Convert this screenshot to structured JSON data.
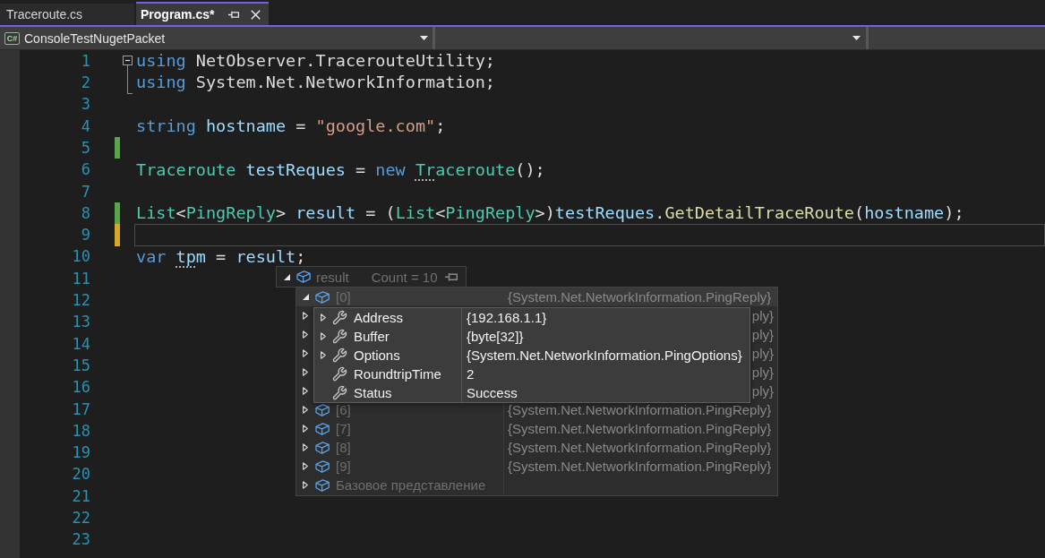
{
  "tabs": [
    {
      "label": "Traceroute.cs",
      "selected": false
    },
    {
      "label": "Program.cs*",
      "selected": true
    }
  ],
  "navigation_bar": [
    {
      "kind": "project",
      "badge": "C#",
      "value": "ConsoleTestNugetPacket"
    },
    {
      "kind": "empty"
    },
    {
      "kind": "clipped"
    }
  ],
  "editor": {
    "lines": [
      {
        "number": "1",
        "expanded": true,
        "tokens": [
          {
            "text": "using",
            "kind": "keyword"
          },
          {
            "text": " NetObserver.TracerouteUtility;",
            "kind": "plain"
          }
        ]
      },
      {
        "number": "2",
        "fold_end": true,
        "tokens": [
          {
            "text": "using",
            "kind": "keyword"
          },
          {
            "text": " System.Net.NetworkInformation;",
            "kind": "plain"
          }
        ]
      },
      {
        "number": "3"
      },
      {
        "number": "4",
        "tokens": [
          {
            "text": "string",
            "kind": "keyword"
          },
          {
            "text": " hostname",
            "kind": "variable"
          },
          {
            "text": " = ",
            "kind": "plain"
          },
          {
            "text": "\"google.com\"",
            "kind": "string"
          },
          {
            "text": ";",
            "kind": "plain"
          }
        ]
      },
      {
        "number": "5",
        "color": "#57a64a"
      },
      {
        "number": "6",
        "tokens": [
          {
            "text": "Traceroute",
            "kind": "type"
          },
          {
            "text": " testReques",
            "kind": "variable"
          },
          {
            "text": " = ",
            "kind": "plain"
          },
          {
            "text": "new ",
            "kind": "keyword"
          },
          {
            "text": "Tr",
            "kind": "type",
            "hint": true
          },
          {
            "text": "aceroute",
            "kind": "type"
          },
          {
            "text": "();",
            "kind": "plain"
          }
        ]
      },
      {
        "number": "7"
      },
      {
        "number": "8",
        "color": "#57a64a",
        "tokens": [
          {
            "text": "List",
            "kind": "type"
          },
          {
            "text": "<",
            "kind": "plain"
          },
          {
            "text": "PingReply",
            "kind": "type"
          },
          {
            "text": "> ",
            "kind": "plain"
          },
          {
            "text": "result",
            "kind": "variable"
          },
          {
            "text": " = (",
            "kind": "plain"
          },
          {
            "text": "List",
            "kind": "type"
          },
          {
            "text": "<",
            "kind": "plain"
          },
          {
            "text": "PingReply",
            "kind": "type"
          },
          {
            "text": ">)",
            "kind": "plain"
          },
          {
            "text": "testReques",
            "kind": "variable"
          },
          {
            "text": ".",
            "kind": "plain"
          },
          {
            "text": "GetDetailTraceRoute",
            "kind": "method"
          },
          {
            "text": "(",
            "kind": "plain"
          },
          {
            "text": "hostname",
            "kind": "variable"
          },
          {
            "text": ");",
            "kind": "plain"
          }
        ]
      },
      {
        "number": "9",
        "current": true,
        "color": "#d7a72a"
      },
      {
        "number": "10",
        "tokens": [
          {
            "text": "var ",
            "kind": "keyword"
          },
          {
            "text": "tp",
            "kind": "variable",
            "hint": true
          },
          {
            "text": "m",
            "kind": "variable"
          },
          {
            "text": " = ",
            "kind": "plain"
          },
          {
            "text": "result",
            "kind": "variable"
          },
          {
            "text": ";",
            "kind": "plain"
          }
        ]
      },
      {
        "number": "11"
      },
      {
        "number": "12"
      },
      {
        "number": "13"
      },
      {
        "number": "14"
      },
      {
        "number": "15"
      },
      {
        "number": "16"
      },
      {
        "number": "17"
      },
      {
        "number": "18"
      },
      {
        "number": "19"
      },
      {
        "number": "20"
      },
      {
        "number": "21"
      },
      {
        "number": "22"
      },
      {
        "number": "23"
      }
    ]
  },
  "datatip": {
    "name": "result",
    "value": "Count = 10",
    "expanded": true,
    "items": [
      {
        "kind": "item",
        "name": "[0]",
        "value": "{System.Net.NetworkInformation.PingReply}",
        "expanded": true,
        "children": [
          {
            "name": "Address",
            "value": "{192.168.1.1}",
            "expandable": true
          },
          {
            "name": "Buffer",
            "value": "{byte[32]}",
            "expandable": true
          },
          {
            "name": "Options",
            "value": "{System.Net.NetworkInformation.PingOptions}",
            "expandable": true
          },
          {
            "name": "RoundtripTime",
            "value": "2",
            "expandable": false
          },
          {
            "name": "Status",
            "value": "Success",
            "expandable": false
          }
        ]
      },
      {
        "kind": "covered",
        "value": "ply}",
        "expanded": false
      },
      {
        "kind": "covered",
        "value": "ply}",
        "expanded": false
      },
      {
        "kind": "covered",
        "value": "ply}",
        "expanded": false
      },
      {
        "kind": "covered",
        "value": "ply}",
        "expanded": false
      },
      {
        "kind": "covered",
        "value": "ply}",
        "expanded": false
      },
      {
        "kind": "item",
        "name": "[6]",
        "value": "{System.Net.NetworkInformation.PingReply}",
        "expanded": false
      },
      {
        "kind": "item",
        "name": "[7]",
        "value": "{System.Net.NetworkInformation.PingReply}",
        "expanded": false
      },
      {
        "kind": "item",
        "name": "[8]",
        "value": "{System.Net.NetworkInformation.PingReply}",
        "expanded": false
      },
      {
        "kind": "item",
        "name": "[9]",
        "value": "{System.Net.NetworkInformation.PingReply}",
        "expanded": false
      },
      {
        "kind": "base",
        "name": "Базовое представление",
        "expanded": false
      }
    ]
  }
}
